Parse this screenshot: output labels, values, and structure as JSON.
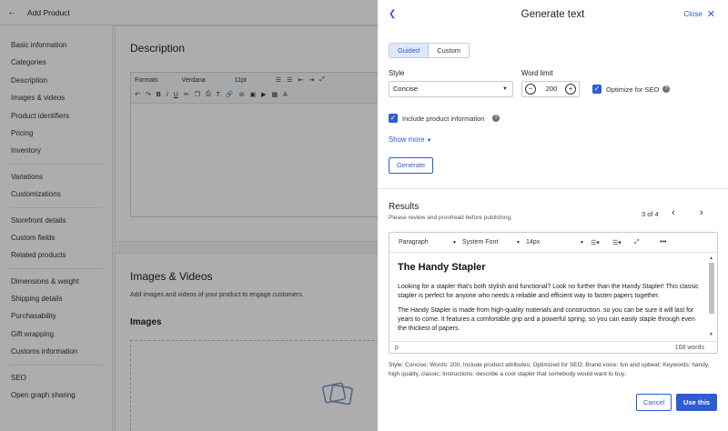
{
  "topbar": {
    "title": "Add Product"
  },
  "sidebar": {
    "groups": [
      [
        "Basic information",
        "Categories",
        "Description",
        "Images & videos",
        "Product identifiers",
        "Pricing",
        "Inventory"
      ],
      [
        "Variations",
        "Customizations"
      ],
      [
        "Storefront details",
        "Custom fields",
        "Related products"
      ],
      [
        "Dimensions & weight",
        "Shipping details",
        "Purchasability",
        "Gift wrapping",
        "Customs information"
      ],
      [
        "SEO",
        "Open graph sharing"
      ]
    ]
  },
  "page": {
    "description_title": "Description",
    "editor": {
      "formats": "Formats",
      "font": "Verdana",
      "size": "11pt"
    },
    "images_title": "Images & Videos",
    "images_sub": "Add images and videos of your product to engage customers.",
    "images_label": "Images"
  },
  "modal": {
    "title": "Generate text",
    "close_label": "Close",
    "tabs": [
      "Guided",
      "Custom"
    ],
    "style_label": "Style",
    "style_value": "Concise",
    "word_limit_label": "Word limit",
    "word_limit_value": "200",
    "optimize_label": "Optimize for SEO",
    "include_label": "Include product information",
    "show_more": "Show more",
    "generate_label": "Generate",
    "results_title": "Results",
    "results_sub": "Please review and proofread before publishing.",
    "pager": "3 of 4",
    "editor": {
      "block": "Paragraph",
      "font": "System Font",
      "size": "14px"
    },
    "result_heading": "The Handy Stapler",
    "result_paragraphs": [
      "Looking for a stapler that's both stylish and functional? Look no further than the Handy Stapler! This classic stapler is perfect for anyone who needs a reliable and efficient way to fasten papers together.",
      "The Handy Stapler is made from high-quality materials and construction. so you can be sure it will last for years to come. It features a comfortable grip and a powerful spring. so you can easily staple through even the thickest of papers."
    ],
    "status_tag": "p",
    "word_count": "168 words",
    "meta": "Style: Concise; Words: 200; Include product attributes; Optimized for SEO; Brand voice: fun and upbeat; Keywords: handy, high quality, classic; Instructions: describe a cool stapler that somebody would want to buy;",
    "cancel_label": "Cancel",
    "use_label": "Use this"
  },
  "colors": {
    "accent": "#2f5bd3",
    "overlay": "rgba(0,0,0,0.32)"
  }
}
